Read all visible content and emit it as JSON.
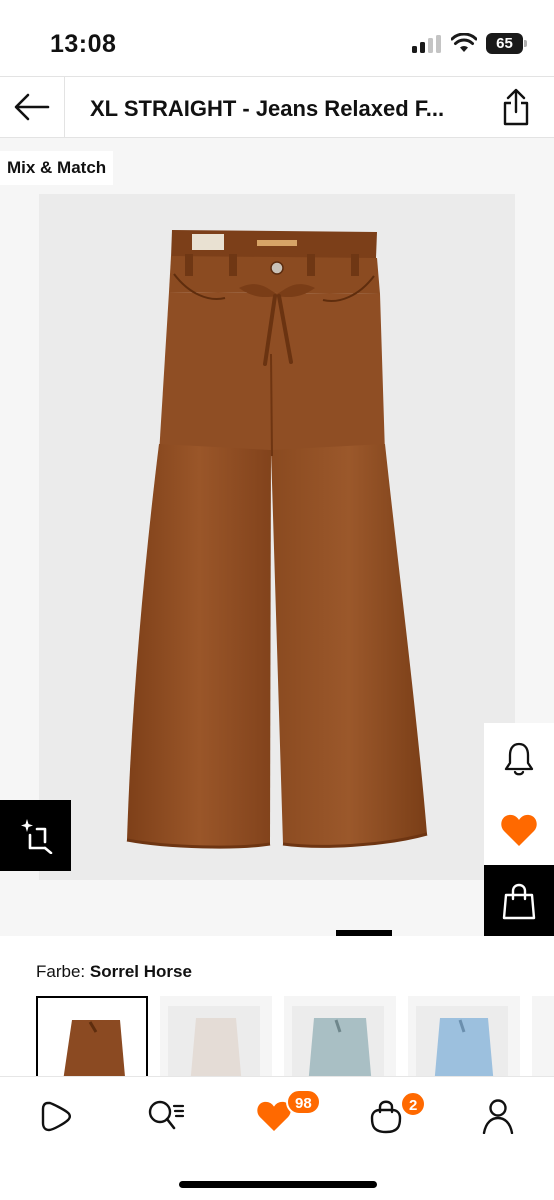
{
  "status_bar": {
    "time": "13:08",
    "battery": "65"
  },
  "header": {
    "back_icon": "arrow-left-icon",
    "title": "XL STRAIGHT - Jeans Relaxed F...",
    "share_icon": "share-icon"
  },
  "gallery": {
    "badge": "Mix & Match",
    "product_image": "brown-wide-leg-jeans",
    "similar_icon": "crop-sparkle-icon",
    "actions": [
      {
        "name": "bell-icon",
        "label": "notify"
      },
      {
        "name": "heart-icon",
        "label": "wishlist"
      },
      {
        "name": "bag-icon",
        "label": "add-to-bag"
      }
    ]
  },
  "color": {
    "label": "Farbe: ",
    "value": "Sorrel Horse",
    "swatches": [
      {
        "color": "#8b4a22",
        "selected": true
      },
      {
        "color": "#e4dcd6",
        "selected": false
      },
      {
        "color": "#a9bfc4",
        "selected": false
      },
      {
        "color": "#9cc0de",
        "selected": false
      }
    ]
  },
  "bottom_nav": {
    "items": [
      {
        "name": "home-icon"
      },
      {
        "name": "search-icon"
      },
      {
        "name": "heart-icon",
        "badge": "98"
      },
      {
        "name": "bag-icon",
        "badge": "2"
      },
      {
        "name": "profile-icon"
      }
    ]
  },
  "colors": {
    "accent": "#ff6900",
    "product": "#8f4e24"
  }
}
